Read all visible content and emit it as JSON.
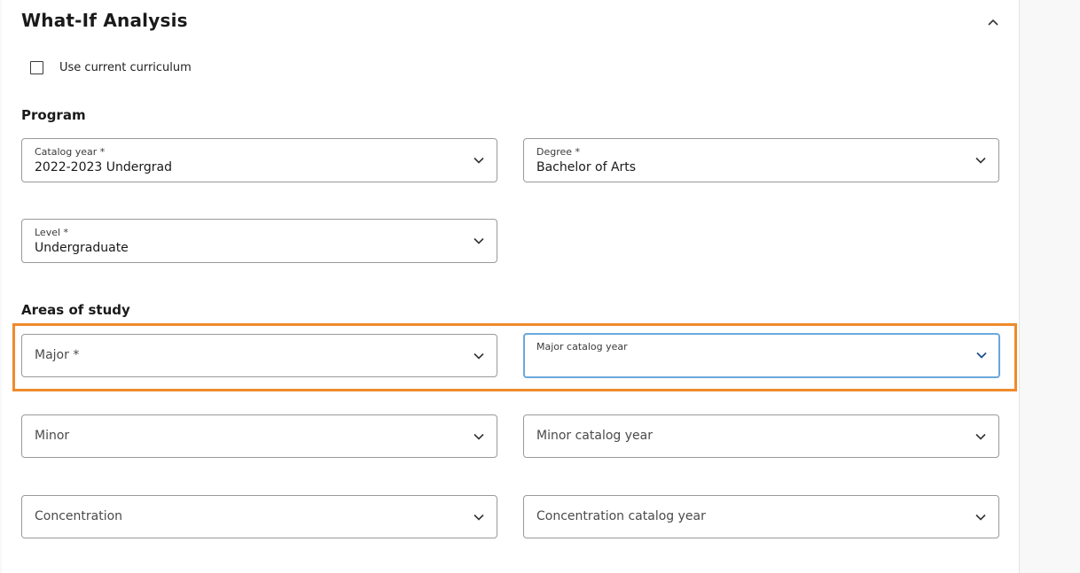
{
  "section": {
    "title": "What-If Analysis"
  },
  "options": {
    "use_current_curriculum_label": "Use current curriculum"
  },
  "program": {
    "heading": "Program",
    "catalog_year": {
      "label": "Catalog year *",
      "value": "2022-2023 Undergrad"
    },
    "degree": {
      "label": "Degree *",
      "value": "Bachelor of Arts"
    },
    "level": {
      "label": "Level *",
      "value": "Undergraduate"
    }
  },
  "areas_of_study": {
    "heading": "Areas of study",
    "major": {
      "placeholder": "Major *"
    },
    "major_catalog_year": {
      "label": "Major catalog year",
      "value": ""
    },
    "minor": {
      "placeholder": "Minor"
    },
    "minor_catalog_year": {
      "placeholder": "Minor catalog year"
    },
    "concentration": {
      "placeholder": "Concentration"
    },
    "concentration_catalog_year": {
      "placeholder": "Concentration catalog year"
    }
  },
  "icons": {
    "collapse": "chevron-up-icon",
    "dropdown": "chevron-down-icon"
  },
  "colors": {
    "highlight": "#f08a2c",
    "focus_border": "#6aa8dc",
    "field_border": "#9a9a9a"
  }
}
